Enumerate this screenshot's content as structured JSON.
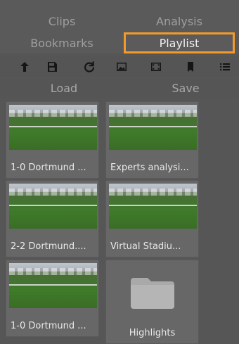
{
  "tabs": {
    "clips": "Clips",
    "analysis": "Analysis",
    "bookmarks": "Bookmarks",
    "playlist": "Playlist"
  },
  "toolbar": {
    "icons": [
      "upload-icon",
      "save-icon",
      "refresh-icon",
      "image-icon",
      "video-icon",
      "bookmark-icon",
      "list-icon"
    ]
  },
  "actions": {
    "load": "Load",
    "save": "Save"
  },
  "playlist": {
    "items": [
      {
        "label": "1-0 Dortmund ..."
      },
      {
        "label": "Experts analysi..."
      },
      {
        "label": "2-2 Dortmund...."
      },
      {
        "label": "Virtual Stadiu..."
      },
      {
        "label": "1-0 Dortmund ..."
      }
    ],
    "folder": {
      "label": "Highlights"
    }
  },
  "colors": {
    "accent": "#f39a2a",
    "panel": "#565656",
    "tile": "#676767"
  }
}
